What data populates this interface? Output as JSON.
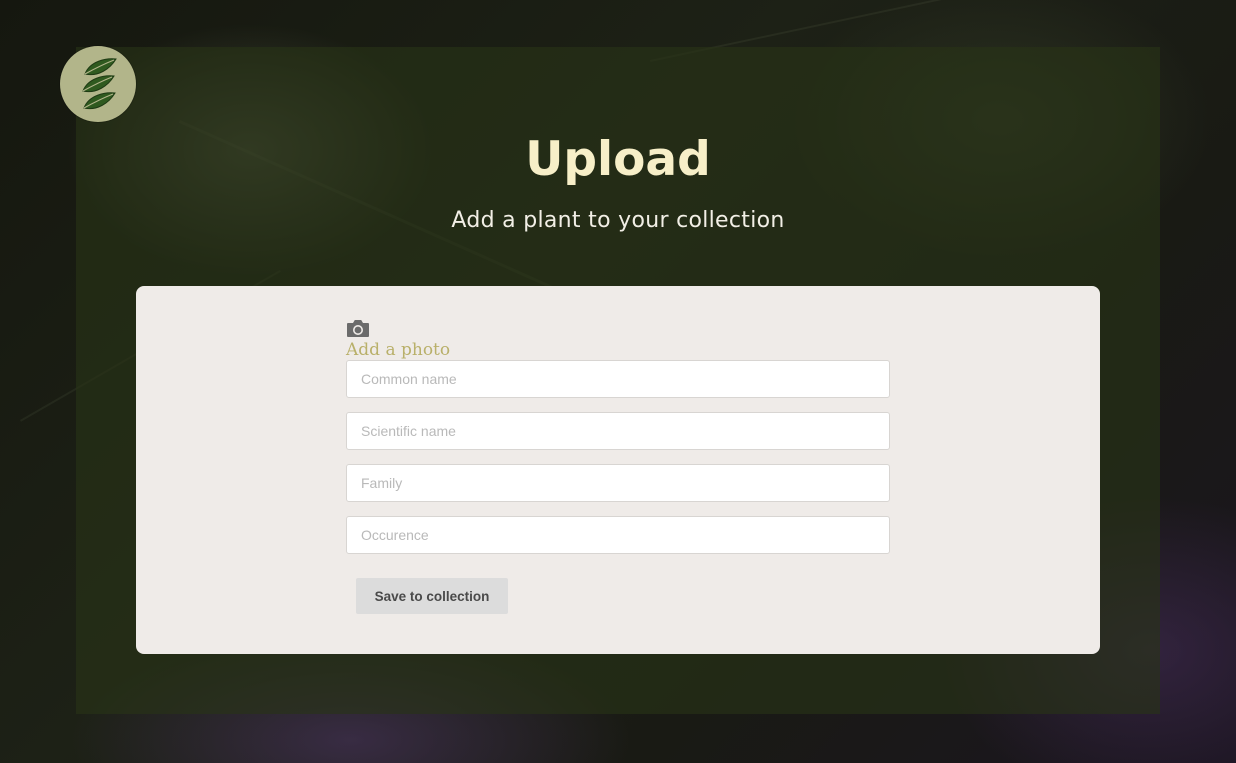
{
  "header": {
    "title": "Upload",
    "subtitle": "Add a plant to your collection"
  },
  "logo": {
    "icon": "leaf-logo-icon",
    "background_color": "#b2b58a",
    "leaf_color": "#2f5a1f"
  },
  "form": {
    "photo": {
      "icon": "camera-icon",
      "label": "Add a photo"
    },
    "fields": {
      "common_name": {
        "placeholder": "Common name",
        "value": ""
      },
      "scientific_name": {
        "placeholder": "Scientific name",
        "value": ""
      },
      "family": {
        "placeholder": "Family",
        "value": ""
      },
      "occurence": {
        "placeholder": "Occurence",
        "value": ""
      }
    },
    "save_label": "Save to collection"
  },
  "colors": {
    "title": "#f7efc8",
    "accent": "#b9b06a",
    "card": "#efebe8",
    "button": "#dcdcdc"
  }
}
